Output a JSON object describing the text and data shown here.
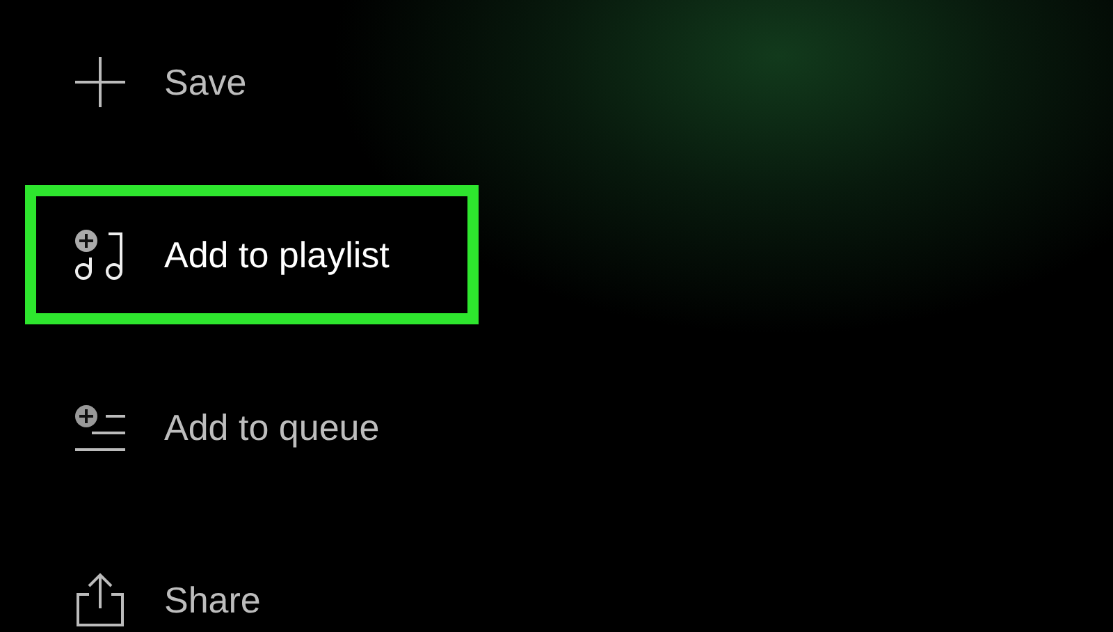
{
  "menu": [
    {
      "kind": "save",
      "label": "Save",
      "highlighted": false
    },
    {
      "kind": "add-to-playlist",
      "label": "Add to playlist",
      "highlighted": true
    },
    {
      "kind": "add-to-queue",
      "label": "Add to queue",
      "highlighted": false
    },
    {
      "kind": "share",
      "label": "Share",
      "highlighted": false
    }
  ]
}
